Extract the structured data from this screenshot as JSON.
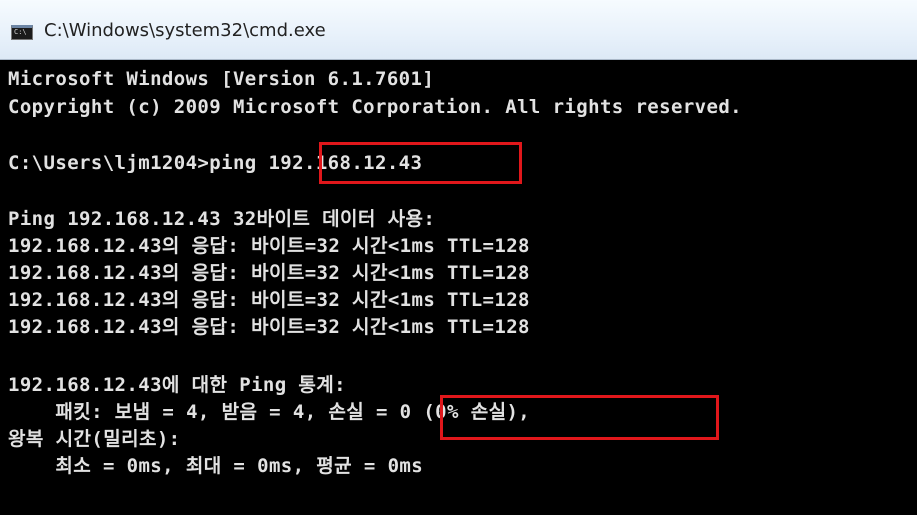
{
  "window": {
    "title": "C:\\Windows\\system32\\cmd.exe",
    "icon": "cmd-icon"
  },
  "console": {
    "lines": [
      "Microsoft Windows [Version 6.1.7601]",
      "Copyright (c) 2009 Microsoft Corporation. All rights reserved.",
      "",
      "C:\\Users\\ljm1204>ping 192.168.12.43",
      "",
      "Ping 192.168.12.43 32바이트 데이터 사용:",
      "192.168.12.43의 응답: 바이트=32 시간<1ms TTL=128",
      "192.168.12.43의 응답: 바이트=32 시간<1ms TTL=128",
      "192.168.12.43의 응답: 바이트=32 시간<1ms TTL=128",
      "192.168.12.43의 응답: 바이트=32 시간<1ms TTL=128",
      "",
      "192.168.12.43에 대한 Ping 통계:",
      "    패킷: 보냄 = 4, 받음 = 4, 손실 = 0 (0% 손실),",
      "왕복 시간(밀리초):",
      "    최소 = 0ms, 최대 = 0ms, 평균 = 0ms"
    ]
  },
  "highlight_color": "#e0171b",
  "colors": {
    "console_bg": "#000000",
    "console_text": "#e2e2e2"
  }
}
